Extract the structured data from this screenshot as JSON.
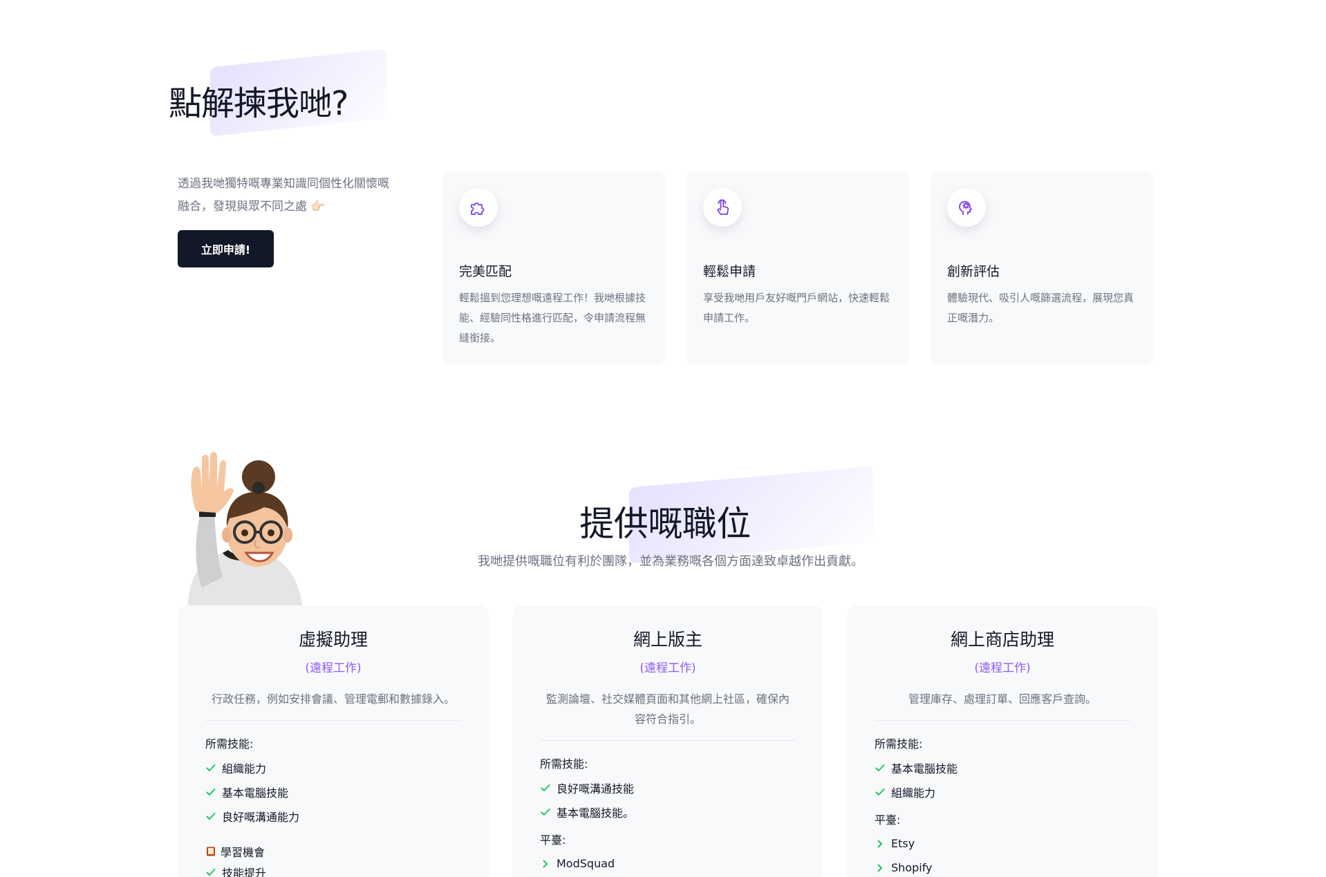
{
  "why": {
    "title": "點解揀我哋?",
    "description": "透過我哋獨特嘅專業知識同個性化關懷嘅融合，發現與眾不同之處 👉🏻",
    "apply_label": "立即申請!",
    "features": [
      {
        "icon": "puzzle-icon",
        "title": "完美匹配",
        "text": "輕鬆搵到您理想嘅遠程工作！我哋根據技能、經驗同性格進行匹配，令申請流程無縫銜接。"
      },
      {
        "icon": "touch-icon",
        "title": "輕鬆申請",
        "text": "享受我哋用戶友好嘅門戶網站，快速輕鬆申請工作。"
      },
      {
        "icon": "brain-gear-icon",
        "title": "創新評估",
        "text": "體驗現代、吸引人嘅篩選流程，展現您真正嘅潛力。"
      }
    ]
  },
  "jobs": {
    "title": "提供嘅職位",
    "subtitle": "我哋提供嘅職位有利於團隊，並為業務嘅各個方面達致卓越作出貢獻。",
    "cards": [
      {
        "title": "虛擬助理",
        "type": "(遠程工作)",
        "description": "行政任務，例如安排會議、管理電郵和數據錄入。",
        "skills_label": "所需技能:",
        "skills": [
          "組織能力",
          "基本電腦技能",
          "良好嘅溝通能力"
        ],
        "learning_label": "學習機會",
        "learning_items": [
          "技能提升"
        ]
      },
      {
        "title": "網上版主",
        "type": "(遠程工作)",
        "description": "監測論壇、社交媒體頁面和其他網上社區，確保內容符合指引。",
        "skills_label": "所需技能:",
        "skills": [
          "良好嘅溝通技能",
          "基本電腦技能。"
        ],
        "platform_label": "平臺:",
        "platforms": [
          "ModSquad"
        ]
      },
      {
        "title": "網上商店助理",
        "type": "(遠程工作)",
        "description": "管理庫存、處理訂單、回應客戶查詢。",
        "skills_label": "所需技能:",
        "skills": [
          "基本電腦技能",
          "組織能力"
        ],
        "platform_label": "平臺:",
        "platforms": [
          "Etsy",
          "Shopify"
        ]
      }
    ]
  },
  "colors": {
    "accent": "#8b5cf6",
    "check": "#22c55e",
    "dark_button": "#111827",
    "card_bg": "#f8f9fb",
    "muted_text": "#6b7280"
  }
}
